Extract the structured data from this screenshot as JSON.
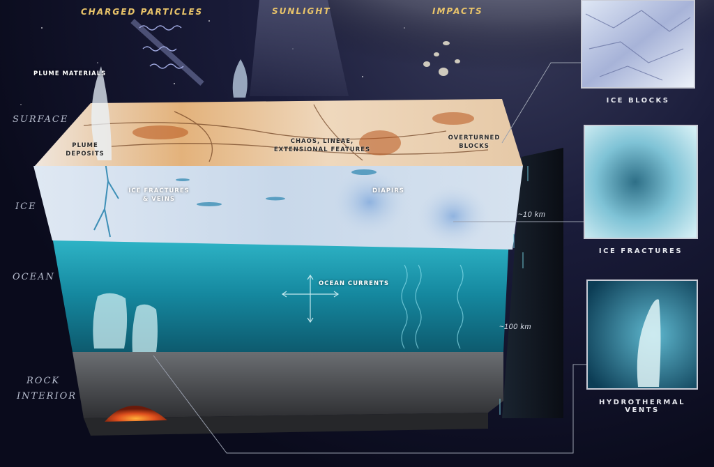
{
  "top_labels": {
    "charged_particles": "CHARGED PARTICLES",
    "sunlight": "SUNLIGHT",
    "impacts": "IMPACTS"
  },
  "layer_labels": {
    "surface": "SURFACE",
    "ice": "ICE",
    "ocean": "OCEAN",
    "rock_interior_line1": "ROCK",
    "rock_interior_line2": "INTERIOR"
  },
  "feature_labels": {
    "plume_materials": "PLUME MATERIALS",
    "plume_deposits_line1": "PLUME",
    "plume_deposits_line2": "DEPOSITS",
    "chaos_line1": "CHAOS, LINEAE,",
    "chaos_line2": "EXTENSIONAL FEATURES",
    "overturned_line1": "OVERTURNED",
    "overturned_line2": "BLOCKS",
    "ice_fractures_line1": "ICE FRACTURES",
    "ice_fractures_line2": "& VEINS",
    "diapirs": "DIAPIRS",
    "ocean_currents": "OCEAN CURRENTS"
  },
  "measurements": {
    "ice_thickness": "~10 km",
    "ocean_depth": "~100 km"
  },
  "insets": [
    {
      "caption": "ICE BLOCKS"
    },
    {
      "caption": "ICE FRACTURES"
    },
    {
      "caption": "HYDROTHERMAL VENTS"
    }
  ],
  "colors": {
    "ocean": "#1fa3b8",
    "ice": "#c9d9ea",
    "surface": "#e2b27a",
    "rock": "#4a4b4e",
    "lava": "#e0501e",
    "label_gold": "#e9c46a"
  }
}
